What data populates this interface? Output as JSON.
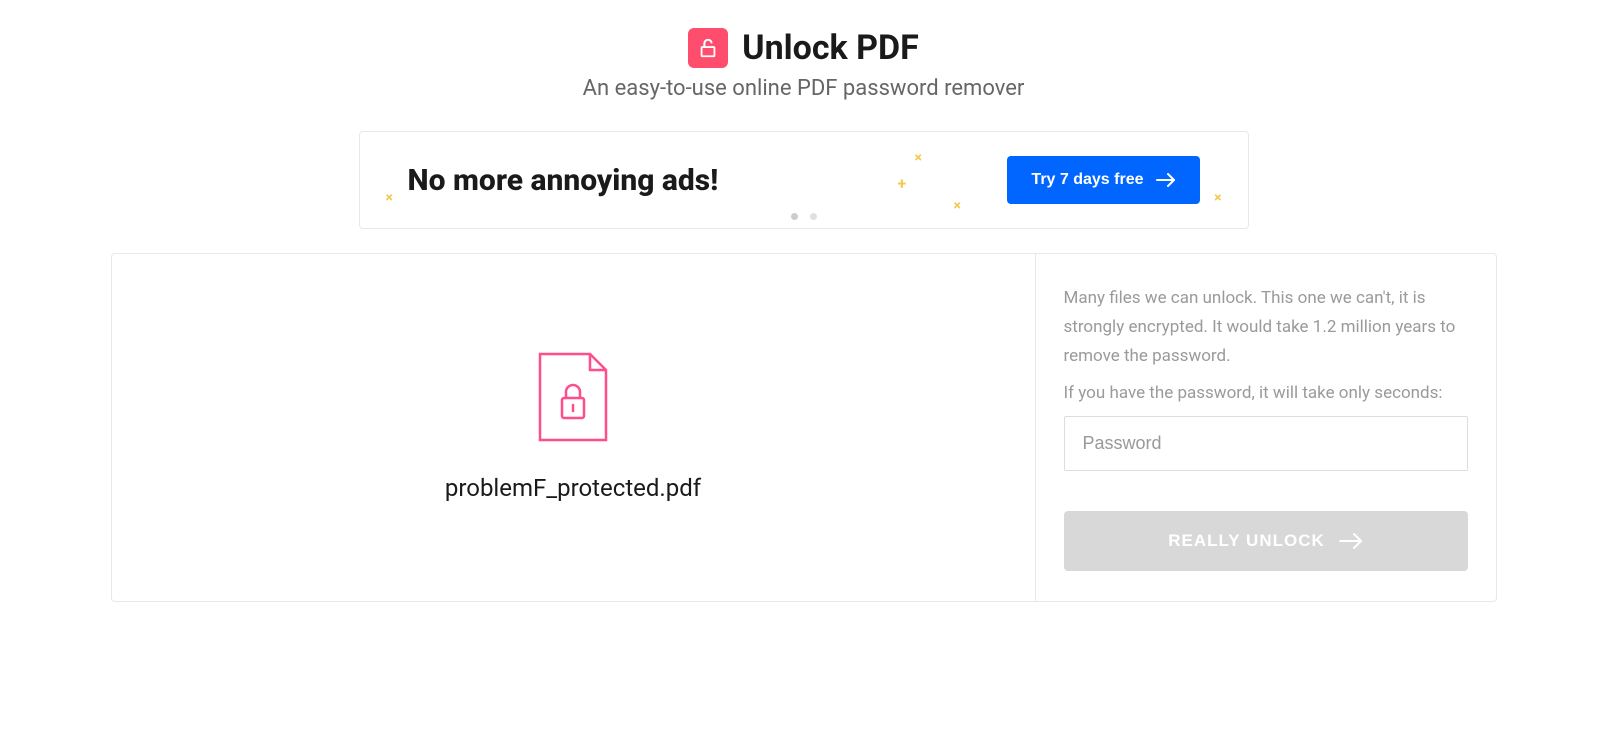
{
  "header": {
    "title": "Unlock PDF",
    "subtitle": "An easy-to-use online PDF password remover"
  },
  "promo": {
    "headline": "No more annoying ads!",
    "cta_label": "Try 7 days free"
  },
  "file": {
    "name": "problemF_protected.pdf"
  },
  "action": {
    "info_line1": "Many files we can unlock. This one we can't, it is strongly encrypted. It would take 1.2 million years to remove the password.",
    "info_line2": "If you have the password, it will take only seconds:",
    "password_placeholder": "Password",
    "unlock_label": "REALLY UNLOCK"
  }
}
